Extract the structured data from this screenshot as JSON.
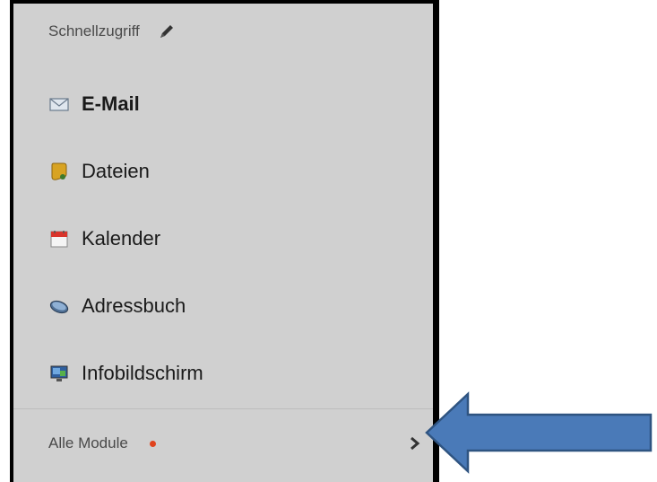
{
  "quick_access": {
    "title": "Schnellzugriff",
    "edit_icon": "pencil-icon"
  },
  "menu": {
    "items": [
      {
        "label": "E-Mail",
        "icon": "envelope-icon",
        "bold": true
      },
      {
        "label": "Dateien",
        "icon": "folder-icon"
      },
      {
        "label": "Kalender",
        "icon": "calendar-icon"
      },
      {
        "label": "Adressbuch",
        "icon": "addressbook-icon"
      },
      {
        "label": "Infobildschirm",
        "icon": "monitor-icon"
      }
    ]
  },
  "footer": {
    "label": "Alle Module",
    "badge_color": "#e0431d",
    "chevron_icon": "chevron-right-icon"
  },
  "annotation": {
    "arrow_color": "#4a7ab8",
    "arrow_icon": "arrow-left-icon"
  }
}
